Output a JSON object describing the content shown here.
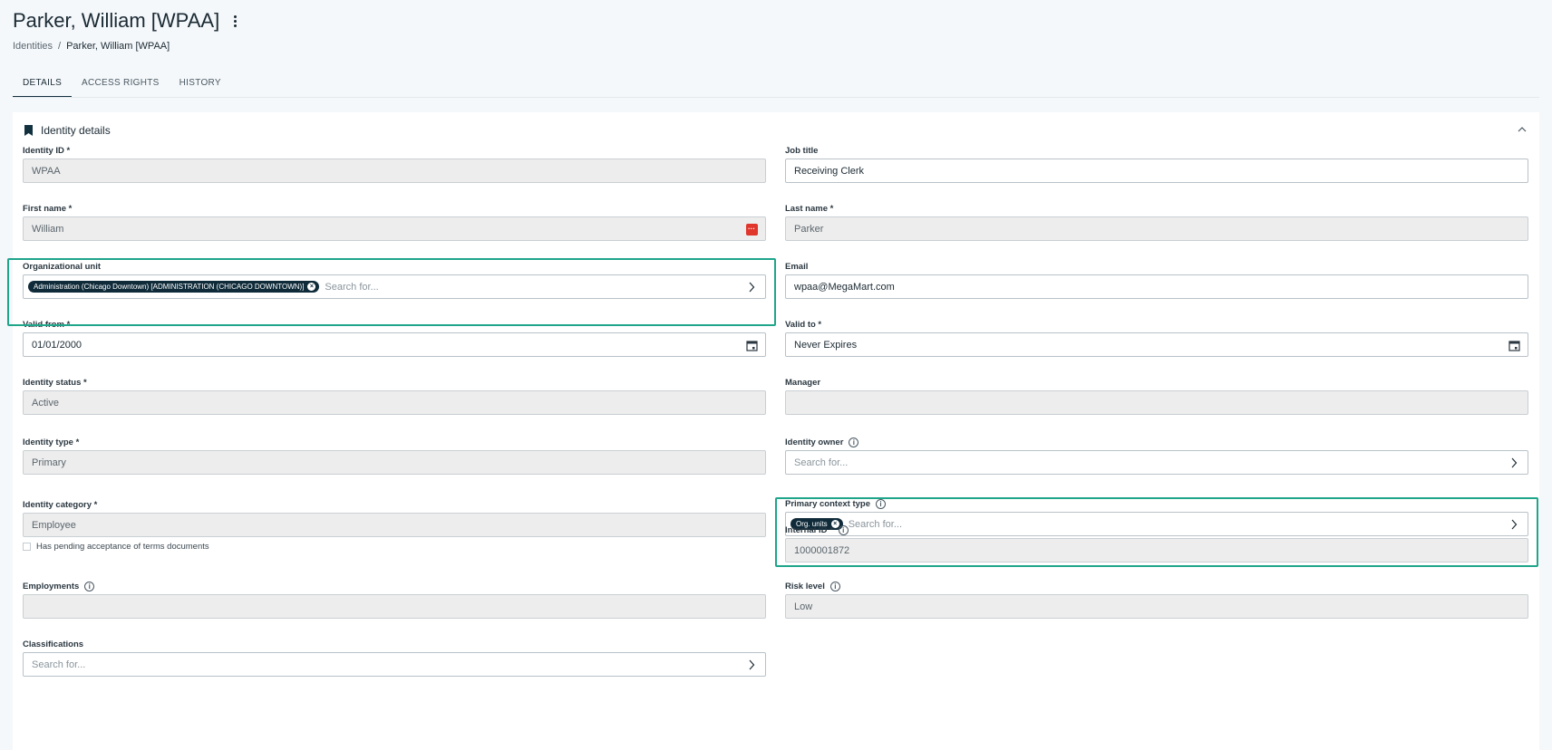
{
  "header": {
    "title": "Parker, William [WPAA]",
    "breadcrumb": [
      "Identities",
      "Parker, William [WPAA]"
    ]
  },
  "tabs": [
    {
      "label": "DETAILS",
      "active": true
    },
    {
      "label": "ACCESS RIGHTS",
      "active": false
    },
    {
      "label": "HISTORY",
      "active": false
    }
  ],
  "card": {
    "title": "Identity details"
  },
  "fields": {
    "identity_id": {
      "label": "Identity ID *",
      "value": "WPAA"
    },
    "job_title": {
      "label": "Job title",
      "value": "Receiving Clerk"
    },
    "first_name": {
      "label": "First name *",
      "value": "William"
    },
    "last_name": {
      "label": "Last name *",
      "value": "Parker"
    },
    "org_unit": {
      "label": "Organizational unit",
      "chip": "Administration (Chicago Downtown) [ADMINISTRATION (CHICAGO DOWNTOWN)]",
      "placeholder": "Search for..."
    },
    "email": {
      "label": "Email",
      "value": "wpaa@MegaMart.com"
    },
    "valid_from": {
      "label": "Valid from *",
      "value": "01/01/2000"
    },
    "valid_to": {
      "label": "Valid to *",
      "value": "Never Expires"
    },
    "identity_status": {
      "label": "Identity status *",
      "value": "Active"
    },
    "manager": {
      "label": "Manager",
      "value": ""
    },
    "identity_type": {
      "label": "Identity type *",
      "value": "Primary"
    },
    "identity_owner": {
      "label": "Identity owner",
      "placeholder": "Search for..."
    },
    "identity_category": {
      "label": "Identity category *",
      "value": "Employee"
    },
    "primary_context_type": {
      "label": "Primary context type",
      "chip": "Org. units",
      "placeholder": "Search for..."
    },
    "internal_id": {
      "label": "Internal ID *",
      "value": "1000001872"
    },
    "pending_terms": {
      "label": "Has pending acceptance of terms documents"
    },
    "employments": {
      "label": "Employments",
      "value": ""
    },
    "risk_level": {
      "label": "Risk level",
      "value": "Low"
    },
    "classifications": {
      "label": "Classifications",
      "placeholder": "Search for..."
    }
  },
  "colors": {
    "accent": "#12313f",
    "highlight": "#1ea58a",
    "chip": "#0f2b3a",
    "alert": "#e0362c"
  }
}
